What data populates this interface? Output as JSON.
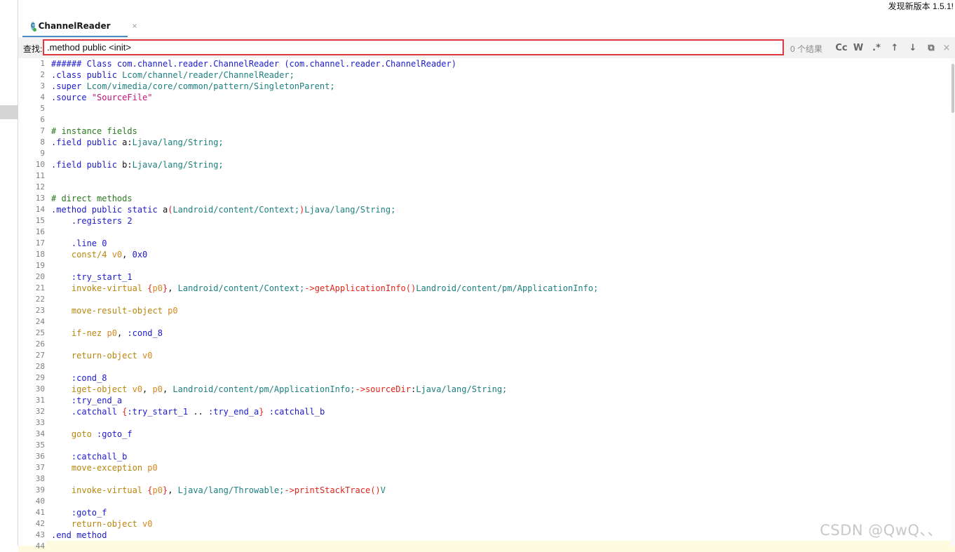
{
  "app": {
    "update_notice": "发现新版本 1.5.1!",
    "watermark": "CSDN @QwQ、、"
  },
  "tab": {
    "title": "ChannelReader",
    "icon_letter": "C",
    "close_glyph": "×"
  },
  "find": {
    "label": "查找:",
    "value": ".method public <init>",
    "count": "0 个结果",
    "buttons": [
      {
        "name": "match-case-button",
        "label": "Cc"
      },
      {
        "name": "whole-word-button",
        "label": "W"
      },
      {
        "name": "regex-button",
        "label": ".*"
      },
      {
        "name": "find-previous-button",
        "label": "↑"
      },
      {
        "name": "find-next-button",
        "label": "↓"
      },
      {
        "name": "find-in-selection-button",
        "label": "⧉"
      },
      {
        "name": "close-find-button",
        "label": "×"
      }
    ]
  },
  "editor": {
    "current_line": 44,
    "lines": [
      [
        [
          "t-def",
          "###### Class com.channel.reader.ChannelReader (com.channel.reader.ChannelReader)"
        ]
      ],
      [
        [
          "t-dir",
          ".class public "
        ],
        [
          "t-type",
          "Lcom/channel/reader/ChannelReader;"
        ]
      ],
      [
        [
          "t-dir",
          ".super "
        ],
        [
          "t-type",
          "Lcom/vimedia/core/common/pattern/SingletonParent;"
        ]
      ],
      [
        [
          "t-dir",
          ".source "
        ],
        [
          "t-str",
          "\"SourceFile\""
        ]
      ],
      [],
      [],
      [
        [
          "t-cm",
          "# instance fields"
        ]
      ],
      [
        [
          "t-dir",
          ".field public "
        ],
        [
          "t-plain",
          "a:"
        ],
        [
          "t-type",
          "Ljava/lang/String;"
        ]
      ],
      [],
      [
        [
          "t-dir",
          ".field public "
        ],
        [
          "t-plain",
          "b:"
        ],
        [
          "t-type",
          "Ljava/lang/String;"
        ]
      ],
      [],
      [],
      [
        [
          "t-cm",
          "# direct methods"
        ]
      ],
      [
        [
          "t-dir",
          ".method public static "
        ],
        [
          "t-plain",
          "a"
        ],
        [
          "t-brace",
          "("
        ],
        [
          "t-type",
          "Landroid/content/Context;"
        ],
        [
          "t-brace",
          ")"
        ],
        [
          "t-type",
          "Ljava/lang/String;"
        ]
      ],
      [
        [
          "t-dir",
          "    .registers "
        ],
        [
          "t-num",
          "2"
        ]
      ],
      [],
      [
        [
          "t-dir",
          "    .line "
        ],
        [
          "t-num",
          "0"
        ]
      ],
      [
        [
          "t-op",
          "    const/4 "
        ],
        [
          "t-reg",
          "v0"
        ],
        [
          "t-plain",
          ", "
        ],
        [
          "t-num",
          "0x0"
        ]
      ],
      [],
      [
        [
          "t-label",
          "    :try_start_1"
        ]
      ],
      [
        [
          "t-op",
          "    invoke-virtual "
        ],
        [
          "t-brace",
          "{"
        ],
        [
          "t-reg",
          "p0"
        ],
        [
          "t-brace",
          "}"
        ],
        [
          "t-plain",
          ", "
        ],
        [
          "t-type",
          "Landroid/content/Context;"
        ],
        [
          "t-meth",
          "->getApplicationInfo"
        ],
        [
          "t-brace",
          "()"
        ],
        [
          "t-type",
          "Landroid/content/pm/ApplicationInfo;"
        ]
      ],
      [],
      [
        [
          "t-op",
          "    move-result-object "
        ],
        [
          "t-reg",
          "p0"
        ]
      ],
      [],
      [
        [
          "t-op",
          "    if-nez "
        ],
        [
          "t-reg",
          "p0"
        ],
        [
          "t-plain",
          ", "
        ],
        [
          "t-label",
          ":cond_8"
        ]
      ],
      [],
      [
        [
          "t-op",
          "    return-object "
        ],
        [
          "t-reg",
          "v0"
        ]
      ],
      [],
      [
        [
          "t-label",
          "    :cond_8"
        ]
      ],
      [
        [
          "t-op",
          "    iget-object "
        ],
        [
          "t-reg",
          "v0"
        ],
        [
          "t-plain",
          ", "
        ],
        [
          "t-reg",
          "p0"
        ],
        [
          "t-plain",
          ", "
        ],
        [
          "t-type",
          "Landroid/content/pm/ApplicationInfo;"
        ],
        [
          "t-meth",
          "->sourceDir"
        ],
        [
          "t-plain",
          ":"
        ],
        [
          "t-type",
          "Ljava/lang/String;"
        ]
      ],
      [
        [
          "t-label",
          "    :try_end_a"
        ]
      ],
      [
        [
          "t-dir",
          "    .catchall "
        ],
        [
          "t-brace",
          "{"
        ],
        [
          "t-label",
          ":try_start_1"
        ],
        [
          "t-plain",
          " .. "
        ],
        [
          "t-label",
          ":try_end_a"
        ],
        [
          "t-brace",
          "}"
        ],
        [
          "t-plain",
          " "
        ],
        [
          "t-label",
          ":catchall_b"
        ]
      ],
      [],
      [
        [
          "t-op",
          "    goto "
        ],
        [
          "t-label",
          ":goto_f"
        ]
      ],
      [],
      [
        [
          "t-label",
          "    :catchall_b"
        ]
      ],
      [
        [
          "t-op",
          "    move-exception "
        ],
        [
          "t-reg",
          "p0"
        ]
      ],
      [],
      [
        [
          "t-op",
          "    invoke-virtual "
        ],
        [
          "t-brace",
          "{"
        ],
        [
          "t-reg",
          "p0"
        ],
        [
          "t-brace",
          "}"
        ],
        [
          "t-plain",
          ", "
        ],
        [
          "t-type",
          "Ljava/lang/Throwable;"
        ],
        [
          "t-meth",
          "->printStackTrace"
        ],
        [
          "t-brace",
          "()"
        ],
        [
          "t-type",
          "V"
        ]
      ],
      [],
      [
        [
          "t-label",
          "    :goto_f"
        ]
      ],
      [
        [
          "t-op",
          "    return-object "
        ],
        [
          "t-reg",
          "v0"
        ]
      ],
      [
        [
          "t-dir",
          ".end method"
        ]
      ],
      []
    ]
  }
}
